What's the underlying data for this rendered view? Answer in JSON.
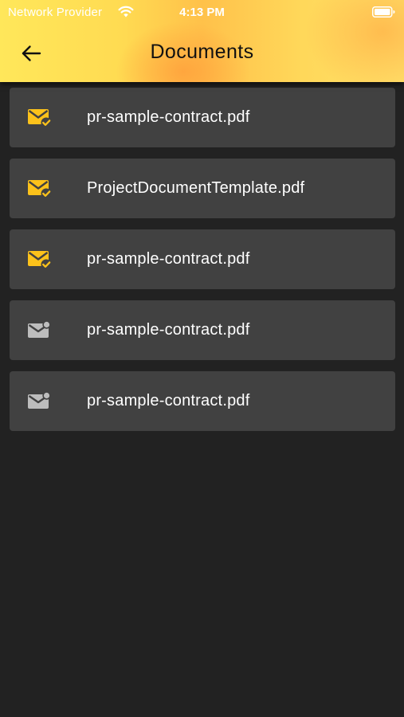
{
  "status_bar": {
    "carrier": "Network Provider",
    "time": "4:13 PM",
    "wifi_icon": "wifi-icon",
    "battery_icon": "battery-icon"
  },
  "header": {
    "back_icon": "arrow-left-icon",
    "title": "Documents"
  },
  "colors": {
    "header_gradient": [
      "#ffe75a",
      "#ffc14a",
      "#ffde68"
    ],
    "background": "#222222",
    "card": "#414141",
    "icon_signed": "#fcc21b",
    "icon_pending": "#bdbdbd"
  },
  "documents": [
    {
      "name": "pr-sample-contract.pdf",
      "status_icon": "mail-check-icon"
    },
    {
      "name": "ProjectDocumentTemplate.pdf",
      "status_icon": "mail-check-icon"
    },
    {
      "name": "pr-sample-contract.pdf",
      "status_icon": "mail-check-icon"
    },
    {
      "name": "pr-sample-contract.pdf",
      "status_icon": "mail-unread-icon"
    },
    {
      "name": "pr-sample-contract.pdf",
      "status_icon": "mail-unread-icon"
    }
  ]
}
